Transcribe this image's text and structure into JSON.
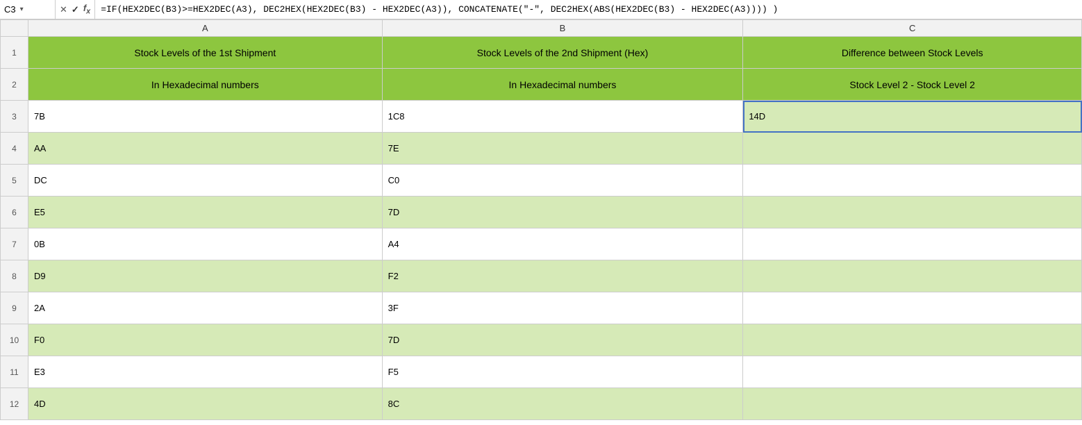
{
  "formulaBar": {
    "cellRef": "C3",
    "formula": "=IF(HEX2DEC(B3)>=HEX2DEC(A3), DEC2HEX(HEX2DEC(B3) - HEX2DEC(A3)), CONCATENATE(\"-\", DEC2HEX(ABS(HEX2DEC(B3) - HEX2DEC(A3))))  )"
  },
  "columns": {
    "headers": [
      "A",
      "B",
      "C"
    ],
    "widths": [
      "510px",
      "520px",
      "488px"
    ]
  },
  "rows": [
    {
      "rowNum": 1,
      "isHeader": true,
      "cells": [
        "Stock Levels of the 1st Shipment",
        "Stock Levels of the 2nd Shipment (Hex)",
        "Difference between Stock Levels"
      ]
    },
    {
      "rowNum": 2,
      "isHeader": true,
      "cells": [
        "In Hexadecimal numbers",
        "In Hexadecimal numbers",
        "Stock Level 2 - Stock Level 2"
      ]
    },
    {
      "rowNum": 3,
      "cells": [
        "7B",
        "1C8",
        "14D"
      ],
      "selected": true
    },
    {
      "rowNum": 4,
      "cells": [
        "AA",
        "7E",
        ""
      ]
    },
    {
      "rowNum": 5,
      "cells": [
        "DC",
        "C0",
        ""
      ]
    },
    {
      "rowNum": 6,
      "cells": [
        "E5",
        "7D",
        ""
      ]
    },
    {
      "rowNum": 7,
      "cells": [
        "0B",
        "A4",
        ""
      ]
    },
    {
      "rowNum": 8,
      "cells": [
        "D9",
        "F2",
        ""
      ]
    },
    {
      "rowNum": 9,
      "cells": [
        "2A",
        "3F",
        ""
      ]
    },
    {
      "rowNum": 10,
      "cells": [
        "F0",
        "7D",
        ""
      ]
    },
    {
      "rowNum": 11,
      "cells": [
        "E3",
        "F5",
        ""
      ]
    },
    {
      "rowNum": 12,
      "cells": [
        "4D",
        "8C",
        ""
      ]
    }
  ]
}
